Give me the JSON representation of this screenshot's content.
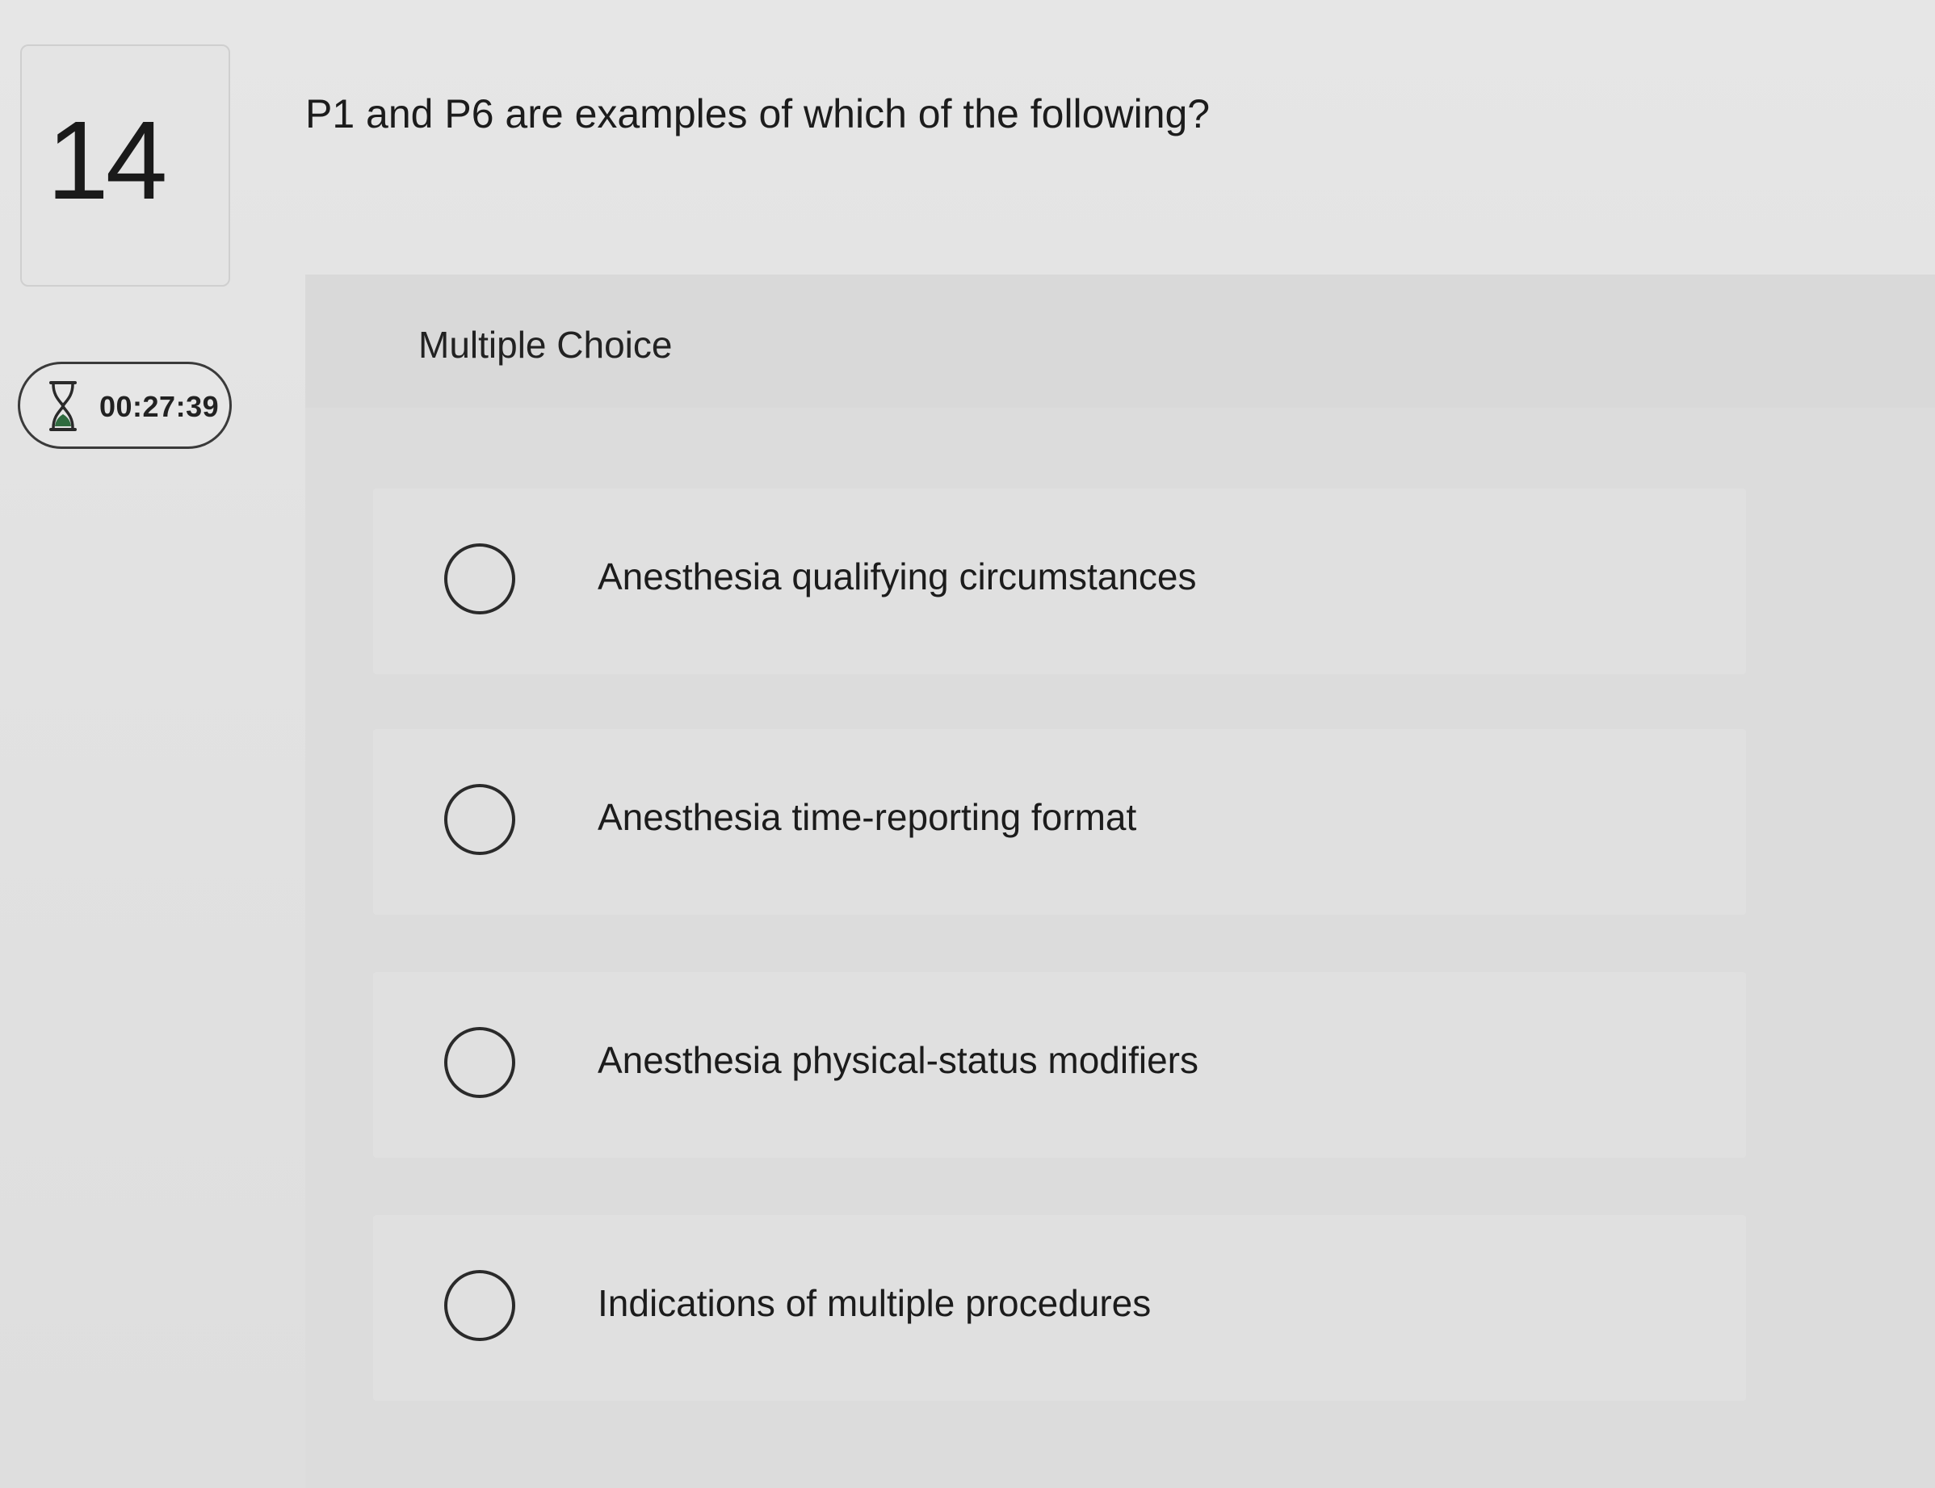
{
  "question": {
    "number": "14",
    "text": "P1 and P6 are examples of which of the following?"
  },
  "timer": {
    "icon": "hourglass-icon",
    "value": "00:27:39"
  },
  "answer_panel": {
    "type_label": "Multiple Choice",
    "options": [
      {
        "label": "Anesthesia qualifying circumstances"
      },
      {
        "label": "Anesthesia time-reporting format"
      },
      {
        "label": "Anesthesia physical-status modifiers"
      },
      {
        "label": "Indications of multiple procedures"
      }
    ]
  },
  "colors": {
    "background": "#e3e3e3",
    "panel": "#dcdcdc",
    "text": "#1c1c1c",
    "timer_icon": "#2f6b3f"
  }
}
